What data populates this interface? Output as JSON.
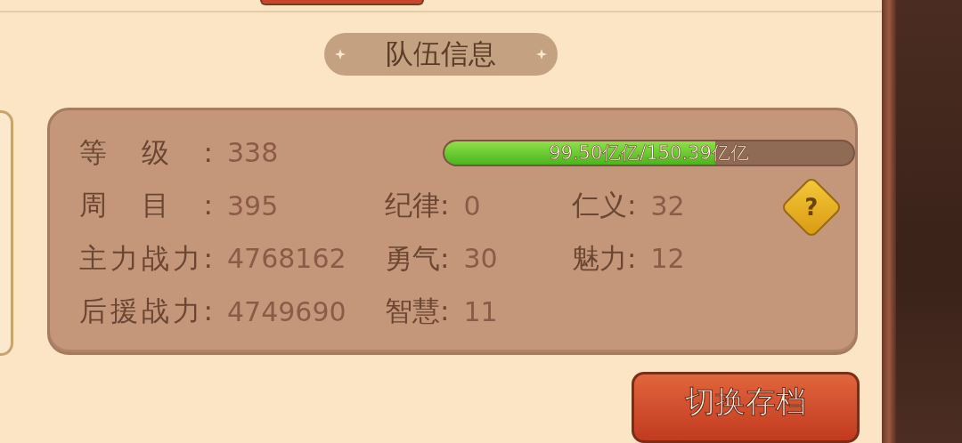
{
  "section_title": "队伍信息",
  "level_row": {
    "label": "等级:",
    "value": "338",
    "progress": {
      "level": 0.6616,
      "text": "99.50亿亿/150.39亿亿"
    }
  },
  "stat_rows": [
    [
      {
        "label": "周目:",
        "value": "395"
      },
      {
        "label": "纪律:",
        "value": "0"
      },
      {
        "label": "仁义:",
        "value": "32"
      }
    ],
    [
      {
        "label": "主力战力:",
        "value": "4768162"
      },
      {
        "label": "勇气:",
        "value": "30"
      },
      {
        "label": "魅力:",
        "value": "12"
      }
    ],
    [
      {
        "label": "后援战力:",
        "value": "4749690"
      },
      {
        "label": "智慧:",
        "value": "11"
      }
    ]
  ],
  "help_icon": "?",
  "switch_button": "切换存档"
}
